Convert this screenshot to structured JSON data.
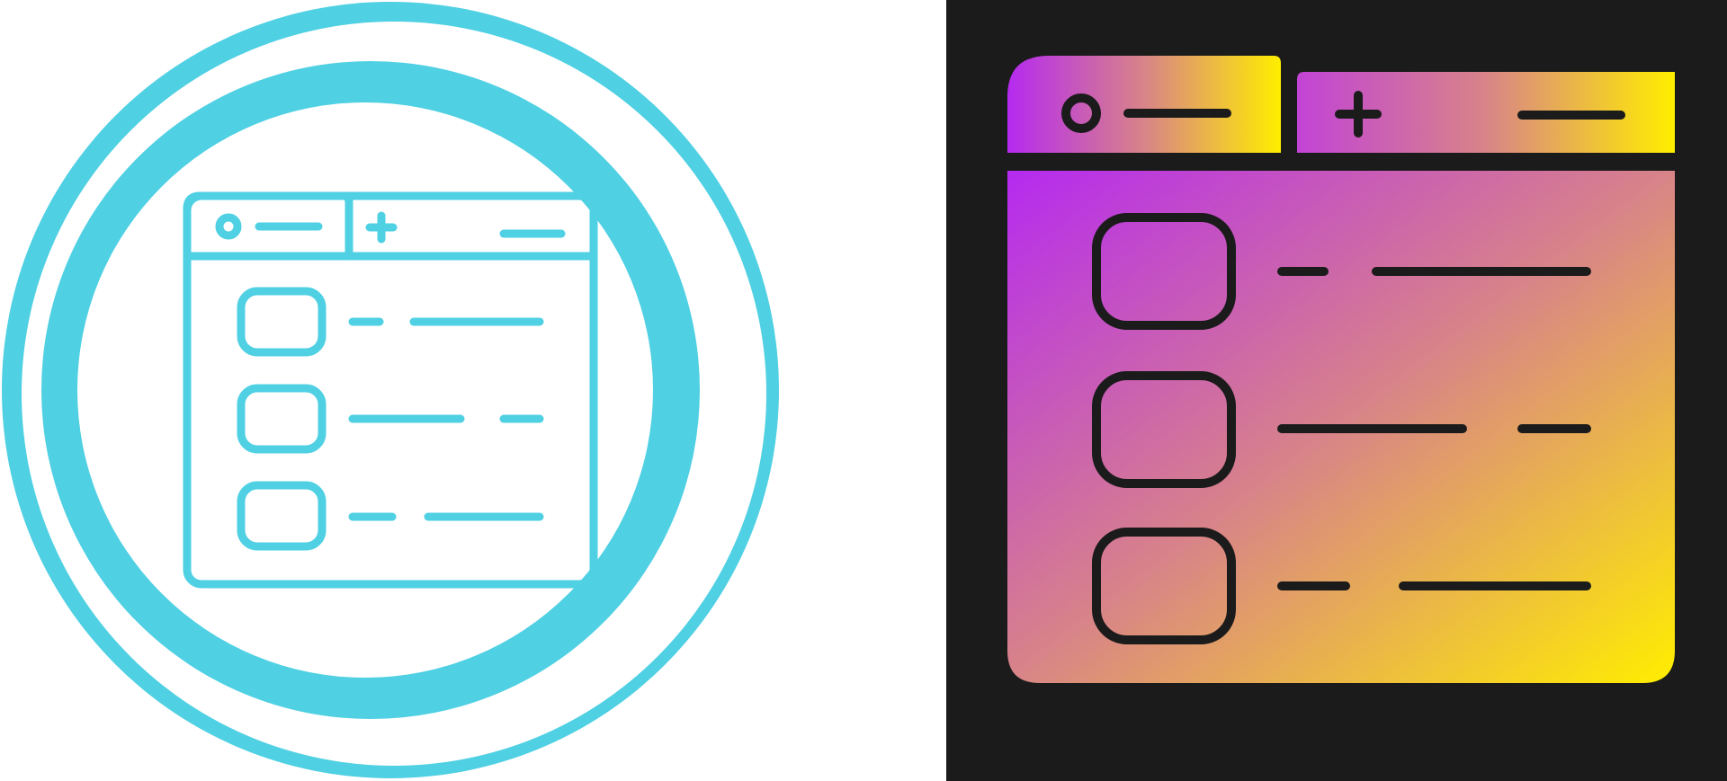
{
  "icons": [
    {
      "name": "browser-tabs-list-icon-outline",
      "style": "line",
      "stroke_color": "#4fd0e3",
      "background": "#ffffff",
      "rows": 3
    },
    {
      "name": "browser-tabs-list-icon-gradient",
      "style": "glyph-gradient",
      "stroke_color": "#1b1b1b",
      "background": "#1b1b1b",
      "gradient_start": "#b52af0",
      "gradient_mid": "#d88488",
      "gradient_end": "#ffee00",
      "rows": 3
    }
  ]
}
